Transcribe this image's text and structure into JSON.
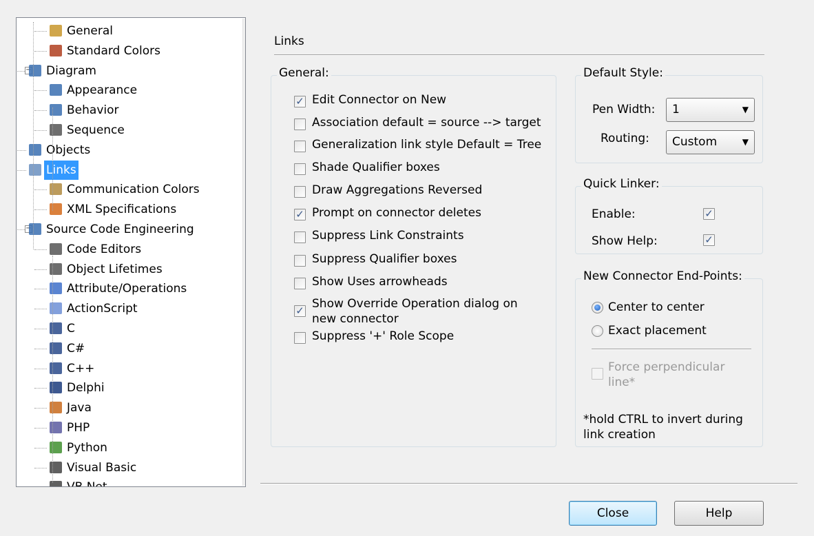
{
  "tree": {
    "items": [
      {
        "label": "General",
        "icon": "general-icon"
      },
      {
        "label": "Standard Colors",
        "icon": "colors-icon"
      },
      {
        "label": "Diagram",
        "icon": "diagram-icon"
      },
      {
        "label": "Appearance",
        "icon": "diagram-icon"
      },
      {
        "label": "Behavior",
        "icon": "diagram-icon"
      },
      {
        "label": "Sequence",
        "icon": "sequence-icon"
      },
      {
        "label": "Objects",
        "icon": "objects-icon"
      },
      {
        "label": "Links",
        "icon": "links-icon"
      },
      {
        "label": "Communication Colors",
        "icon": "palette-icon"
      },
      {
        "label": "XML Specifications",
        "icon": "xml-icon"
      },
      {
        "label": "Source Code Engineering",
        "icon": "source-code-icon"
      },
      {
        "label": "Code Editors",
        "icon": "code-editor-icon"
      },
      {
        "label": "Object Lifetimes",
        "icon": "code-editor-icon"
      },
      {
        "label": "Attribute/Operations",
        "icon": "attribute-icon"
      },
      {
        "label": "ActionScript",
        "icon": "actionscript-icon"
      },
      {
        "label": "C",
        "icon": "c-icon"
      },
      {
        "label": "C#",
        "icon": "csharp-icon"
      },
      {
        "label": "C++",
        "icon": "cpp-icon"
      },
      {
        "label": "Delphi",
        "icon": "delphi-icon"
      },
      {
        "label": "Java",
        "icon": "java-icon"
      },
      {
        "label": "PHP",
        "icon": "php-icon"
      },
      {
        "label": "Python",
        "icon": "python-icon"
      },
      {
        "label": "Visual Basic",
        "icon": "vb-icon"
      },
      {
        "label": "VB.Net",
        "icon": "vbnet-icon"
      }
    ],
    "selected": "Links",
    "expander_collapse": "−",
    "scroll_up": "▲",
    "scroll_down": "▼",
    "scroll_grip": "≡"
  },
  "page": {
    "title": "Links"
  },
  "general": {
    "legend": "General:",
    "options": [
      {
        "label": "Edit Connector on New",
        "checked": true
      },
      {
        "label": "Association default = source --> target",
        "checked": false
      },
      {
        "label": "Generalization link style Default = Tree",
        "checked": false
      },
      {
        "label": "Shade Qualifier boxes",
        "checked": false
      },
      {
        "label": "Draw Aggregations Reversed",
        "checked": false
      },
      {
        "label": "Prompt on connector deletes",
        "checked": true
      },
      {
        "label": "Suppress Link Constraints",
        "checked": false
      },
      {
        "label": "Suppress Qualifier boxes",
        "checked": false
      },
      {
        "label": "Show Uses arrowheads",
        "checked": false
      },
      {
        "label": "Show Override Operation dialog on",
        "label2": "new connector",
        "checked": true
      },
      {
        "label": "Suppress '+' Role Scope",
        "checked": false
      }
    ]
  },
  "default_style": {
    "legend": "Default Style:",
    "pen_width_label": "Pen Width:",
    "pen_width_value": "1",
    "routing_label": "Routing:",
    "routing_value": "Custom",
    "caret": "▼"
  },
  "quick_linker": {
    "legend": "Quick Linker:",
    "enable_label": "Enable:",
    "enable_checked": true,
    "show_help_label": "Show Help:",
    "show_help_checked": true
  },
  "end_points": {
    "legend": "New Connector End-Points:",
    "options": [
      {
        "label": "Center to center",
        "selected": true
      },
      {
        "label": "Exact placement",
        "selected": false
      }
    ],
    "force_label_1": "Force perpendicular",
    "force_label_2": "line*",
    "note_1": "*hold CTRL to invert during",
    "note_2": "link creation"
  },
  "buttons": {
    "close": "Close",
    "help": "Help"
  },
  "check_glyph": "✓",
  "colors": {
    "selection": "#3399ff",
    "accent": "#3c7fb1"
  }
}
